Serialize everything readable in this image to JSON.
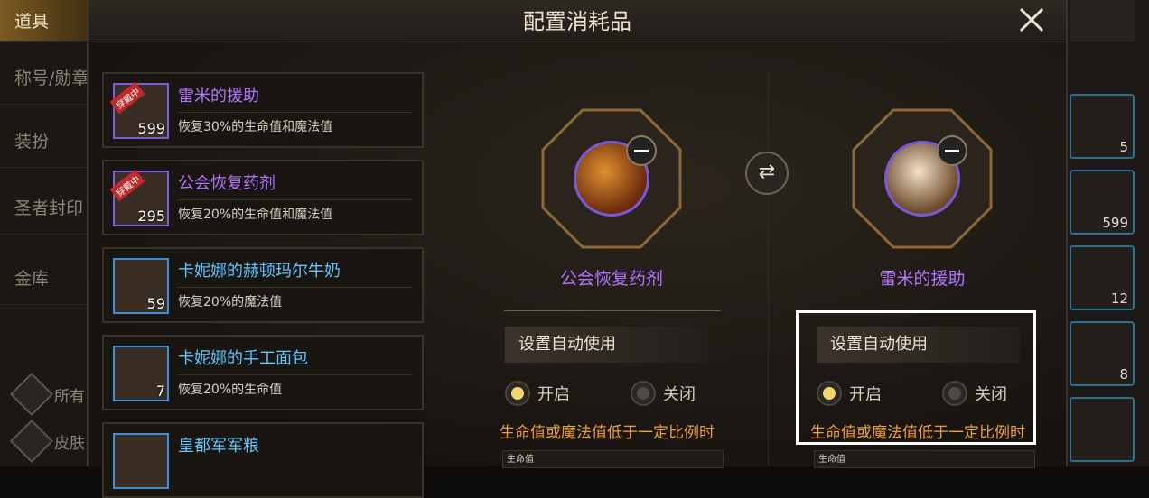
{
  "left_nav": {
    "tabs": [
      "道具",
      "称号/勋章",
      "装扮",
      "圣者封印",
      "金库"
    ],
    "filters": [
      "所有",
      "皮肤"
    ]
  },
  "dialog": {
    "title": "配置消耗品",
    "items": [
      {
        "name": "雷米的援助",
        "desc": "恢复30%的生命值和魔法值",
        "qty": "599",
        "badge": "穿戴中",
        "color": "purple"
      },
      {
        "name": "公会恢复药剂",
        "desc": "恢复20%的生命值和魔法值",
        "qty": "295",
        "badge": "穿戴中",
        "color": "purple"
      },
      {
        "name": "卡妮娜的赫顿玛尔牛奶",
        "desc": "恢复20%的魔法值",
        "qty": "59",
        "color": "blue"
      },
      {
        "name": "卡妮娜的手工面包",
        "desc": "恢复20%的生命值",
        "qty": "7",
        "color": "blue"
      },
      {
        "name": "皇都军军粮",
        "color": "blue"
      }
    ],
    "slots": [
      {
        "name": "公会恢复药剂"
      },
      {
        "name": "雷米的援助"
      }
    ],
    "auto_use": {
      "title": "设置自动使用",
      "on": "开启",
      "off": "关闭",
      "condition": "生命值或魔法值低于一定比例时",
      "hp_label": "生命值"
    }
  },
  "right_strip": {
    "counts": [
      "5",
      "599",
      "12",
      "8",
      ""
    ]
  }
}
